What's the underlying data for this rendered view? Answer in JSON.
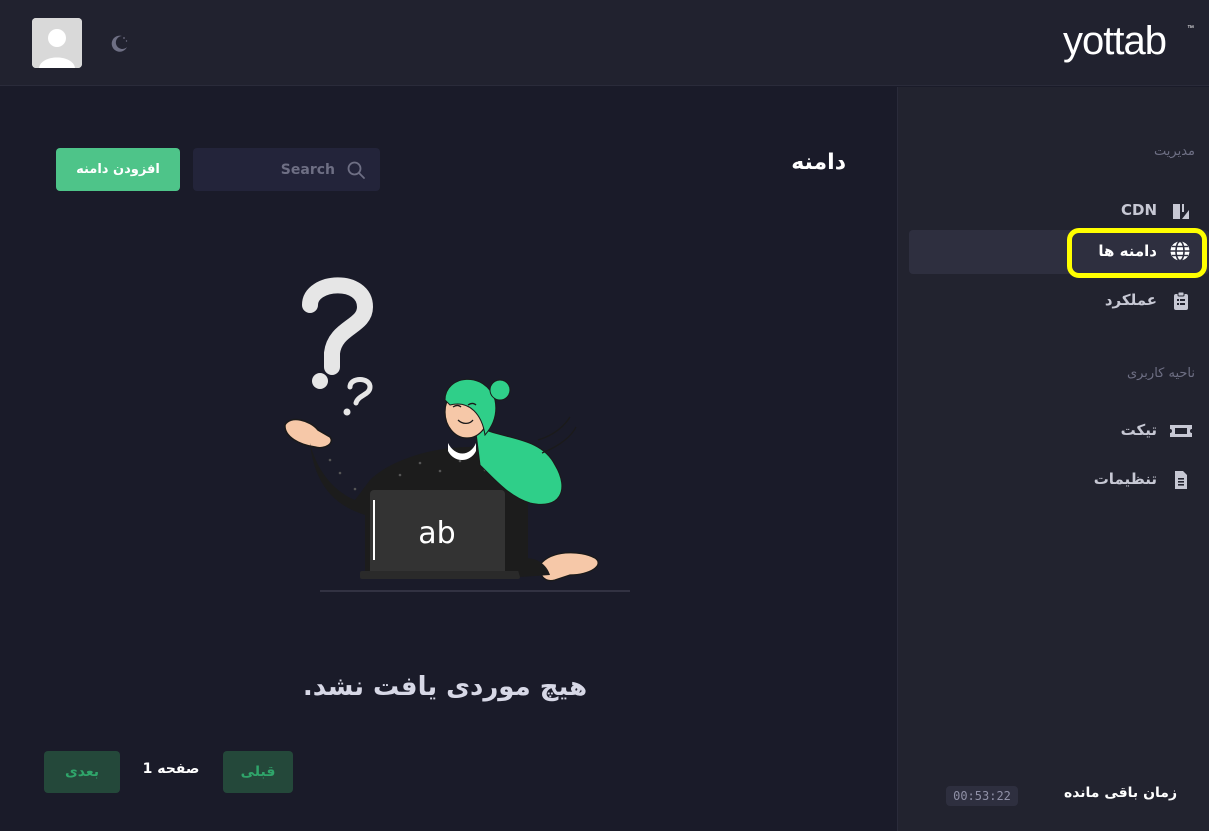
{
  "header": {
    "logo_text": "yottab",
    "avatar_icon": "user-avatar-icon",
    "theme_icon": "moon-icon"
  },
  "sidebar": {
    "sections": [
      {
        "title": "مدیریت"
      },
      {
        "title": "ناحیه کاربری"
      }
    ],
    "items": [
      {
        "label": "CDN",
        "icon": "cdn-icon"
      },
      {
        "label": "دامنه ها",
        "icon": "globe-icon",
        "active": true
      },
      {
        "label": "عملکرد",
        "icon": "clipboard-icon"
      },
      {
        "label": "تیکت",
        "icon": "ticket-icon"
      },
      {
        "label": "تنظیمات",
        "icon": "document-icon"
      }
    ],
    "timer": {
      "label": "زمان باقی مانده",
      "value": "00:53:22"
    }
  },
  "main": {
    "title": "دامنه",
    "search": {
      "placeholder": "Search",
      "value": ""
    },
    "add_button": "افزودن دامنه",
    "empty_message": "هیچ موردی یافت نشد.",
    "illustration_laptop_text": "ab",
    "pagination": {
      "prev_label": "قبلی",
      "next_label": "بعدی",
      "page_label": "صفحه 1"
    }
  },
  "colors": {
    "accent_green": "#4ec489",
    "highlight_yellow": "#ffff00",
    "background": "#1a1b29",
    "sidebar_bg": "#22232f"
  }
}
